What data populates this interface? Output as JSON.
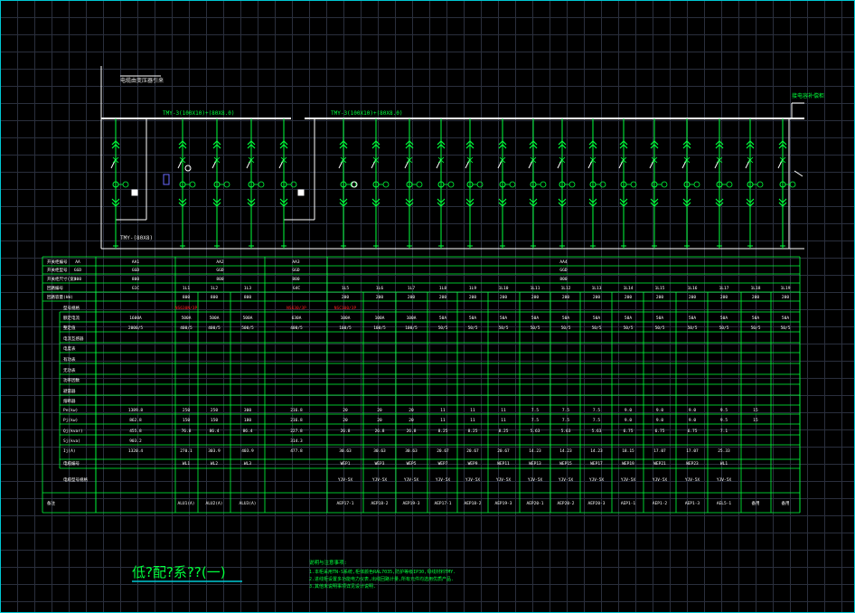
{
  "title": "低?配?系??(一)",
  "notes_title": "说明与注意事项:",
  "notes": [
    "1.本柜采用TN-S系统,柜体颜色RAL7035,防护等级IP30,母线材料TMY.",
    "2.进线柜设置多功能电力仪表,出线回路计量,所有元件均选用优质产品.",
    "3.其他未说明事项详见设计说明."
  ],
  "busbar_labels": {
    "incoming": "电缆由变压器引来",
    "bus_left": "TMY-3(100X10)+(80X8.0)",
    "bus_right": "TMY-3(100X10)+(80X8.0)",
    "bus_end": "接电容补偿柜",
    "bottom_bus": "TMY-(80X8)"
  },
  "colors": {
    "line": "#00ff3c",
    "white": "#ffffff",
    "red": "#ff2020",
    "cyan": "#00c8d4",
    "label": "#e8e8e8"
  },
  "table": {
    "row_labels": [
      "开关柜编号",
      "开关柜型号",
      "开关柜尺寸(宽)",
      "回路编号",
      "回路容量(kW)",
      "型号规格",
      "额定电流",
      "整定值",
      "电流互感器",
      "电度表",
      "有功表",
      "无功表",
      "功率因数",
      "避雷器",
      "熔断器",
      "Pe(kw)",
      "Pj(kw)",
      "Qj(kvar)",
      "Sj(kva)",
      "Ij(A)",
      "电缆编号",
      "电缆型号规格",
      "备注"
    ],
    "cabinet_header": {
      "no": "AA",
      "type": "GGD",
      "width": "800"
    },
    "cabinets": [
      {
        "id": "AA1",
        "type": "GGD",
        "width": "800"
      },
      {
        "id": "AA2",
        "type": "GGD",
        "width": "800"
      },
      {
        "id": "AA3",
        "type": "GGD",
        "width": "800"
      },
      {
        "id": "AA4",
        "type": "GGD",
        "width": "800"
      }
    ],
    "circuits": [
      {
        "no": "G1C",
        "cap": "",
        "switch": "",
        "In": "1600A",
        "set": "2000/5",
        "Pe": "1389.8",
        "Pj": "862.8",
        "Qj": "455.8",
        "Sj": "903.2",
        "Ij": "1320.4",
        "cable": "",
        "spec": "",
        "remark": ""
      },
      {
        "no": "1L1",
        "cap": "800",
        "switch": "NS630N/3P",
        "In": "500A",
        "set": "400/5",
        "Pe": "250",
        "Pj": "150",
        "Qj": "76.8",
        "Sj": "",
        "Ij": "270.1",
        "cable": "WL1",
        "spec": "",
        "remark": "ALU1(A)"
      },
      {
        "no": "1L2",
        "cap": "800",
        "switch": "",
        "In": "500A",
        "set": "400/5",
        "Pe": "250",
        "Pj": "150",
        "Qj": "86.4",
        "Sj": "",
        "Ij": "303.9",
        "cable": "WL2",
        "spec": "",
        "remark": "ALU2(A)"
      },
      {
        "no": "1L3",
        "cap": "800",
        "switch": "",
        "In": "500A",
        "set": "500/5",
        "Pe": "300",
        "Pj": "180",
        "Qj": "86.4",
        "Sj": "",
        "Ij": "403.9",
        "cable": "WL3",
        "spec": "",
        "remark": "ALU3(A)"
      },
      {
        "no": "G4C",
        "cap": "",
        "switch": "NS630/3P",
        "In": "630A",
        "set": "400/5",
        "Pe": "216.8",
        "Pj": "216.8",
        "Qj": "227.8",
        "Sj": "314.3",
        "Ij": "477.8",
        "cable": "",
        "spec": "",
        "remark": ""
      },
      {
        "no": "1L5",
        "cap": "200",
        "switch": "NSC100/3P",
        "In": "100A",
        "set": "100/5",
        "Pe": "20",
        "Pj": "20",
        "Qj": "26.8",
        "Sj": "",
        "Ij": "30.63",
        "cable": "WEP1",
        "spec": "YJV-5X",
        "remark": "AEP17-1"
      },
      {
        "no": "1L6",
        "cap": "200",
        "switch": "",
        "In": "100A",
        "set": "100/5",
        "Pe": "20",
        "Pj": "20",
        "Qj": "26.8",
        "Sj": "",
        "Ij": "30.63",
        "cable": "WEP3",
        "spec": "YJV-5X",
        "remark": "AEP18-2"
      },
      {
        "no": "1L7",
        "cap": "200",
        "switch": "",
        "In": "100A",
        "set": "100/5",
        "Pe": "20",
        "Pj": "20",
        "Qj": "26.8",
        "Sj": "",
        "Ij": "30.63",
        "cable": "WEP5",
        "spec": "YJV-5X",
        "remark": "AEP19-3"
      },
      {
        "no": "1L8",
        "cap": "200",
        "switch": "",
        "In": "50A",
        "set": "50/5",
        "Pe": "11",
        "Pj": "11",
        "Qj": "8.25",
        "Sj": "",
        "Ij": "20.67",
        "cable": "WEP7",
        "spec": "YJV-5X",
        "remark": "AEP17-1"
      },
      {
        "no": "1L9",
        "cap": "200",
        "switch": "",
        "In": "50A",
        "set": "50/5",
        "Pe": "11",
        "Pj": "11",
        "Qj": "8.25",
        "Sj": "",
        "Ij": "20.67",
        "cable": "WEP9",
        "spec": "YJV-5X",
        "remark": "AEP18-2"
      },
      {
        "no": "1L10",
        "cap": "200",
        "switch": "",
        "In": "50A",
        "set": "50/5",
        "Pe": "11",
        "Pj": "11",
        "Qj": "8.25",
        "Sj": "",
        "Ij": "20.67",
        "cable": "WEP11",
        "spec": "YJV-5X",
        "remark": "AEP19-3"
      },
      {
        "no": "1L11",
        "cap": "200",
        "switch": "",
        "In": "50A",
        "set": "50/5",
        "Pe": "7.5",
        "Pj": "7.5",
        "Qj": "5.63",
        "Sj": "",
        "Ij": "14.23",
        "cable": "WEP13",
        "spec": "YJV-5X",
        "remark": "AEP20-1"
      },
      {
        "no": "1L12",
        "cap": "200",
        "switch": "",
        "In": "50A",
        "set": "50/5",
        "Pe": "7.5",
        "Pj": "7.5",
        "Qj": "5.63",
        "Sj": "",
        "Ij": "14.23",
        "cable": "WEP15",
        "spec": "YJV-5X",
        "remark": "AEP20-2"
      },
      {
        "no": "1L13",
        "cap": "200",
        "switch": "",
        "In": "50A",
        "set": "50/5",
        "Pe": "7.5",
        "Pj": "7.5",
        "Qj": "5.63",
        "Sj": "",
        "Ij": "14.23",
        "cable": "WEP17",
        "spec": "YJV-5X",
        "remark": "AEP20-3"
      },
      {
        "no": "1L14",
        "cap": "200",
        "switch": "",
        "In": "50A",
        "set": "50/5",
        "Pe": "9.0",
        "Pj": "9.0",
        "Qj": "6.75",
        "Sj": "",
        "Ij": "18.15",
        "cable": "WEP19",
        "spec": "YJV-5X",
        "remark": "AEP1-1"
      },
      {
        "no": "1L15",
        "cap": "200",
        "switch": "",
        "In": "50A",
        "set": "50/5",
        "Pe": "9.0",
        "Pj": "9.0",
        "Qj": "6.75",
        "Sj": "",
        "Ij": "17.07",
        "cable": "WEP21",
        "spec": "YJV-5X",
        "remark": "AEP1-2"
      },
      {
        "no": "1L16",
        "cap": "200",
        "switch": "",
        "In": "50A",
        "set": "50/5",
        "Pe": "9.0",
        "Pj": "9.0",
        "Qj": "6.75",
        "Sj": "",
        "Ij": "17.07",
        "cable": "WEP23",
        "spec": "YJV-5X",
        "remark": "AEP1-3"
      },
      {
        "no": "1L17",
        "cap": "200",
        "switch": "",
        "In": "50A",
        "set": "50/5",
        "Pe": "9.5",
        "Pj": "9.5",
        "Qj": "7.1",
        "Sj": "",
        "Ij": "25.33",
        "cable": "WL1",
        "spec": "YJV-5X",
        "remark": "AEL5-1"
      },
      {
        "no": "1L18",
        "cap": "200",
        "switch": "",
        "In": "50A",
        "set": "50/5",
        "Pe": "15",
        "Pj": "15",
        "Qj": "",
        "Sj": "",
        "Ij": "",
        "cable": "",
        "spec": "",
        "remark": "备用"
      },
      {
        "no": "1L19",
        "cap": "200",
        "switch": "",
        "In": "50A",
        "set": "50/5",
        "Pe": "",
        "Pj": "",
        "Qj": "",
        "Sj": "",
        "Ij": "",
        "cable": "",
        "spec": "",
        "remark": "备用"
      }
    ]
  }
}
